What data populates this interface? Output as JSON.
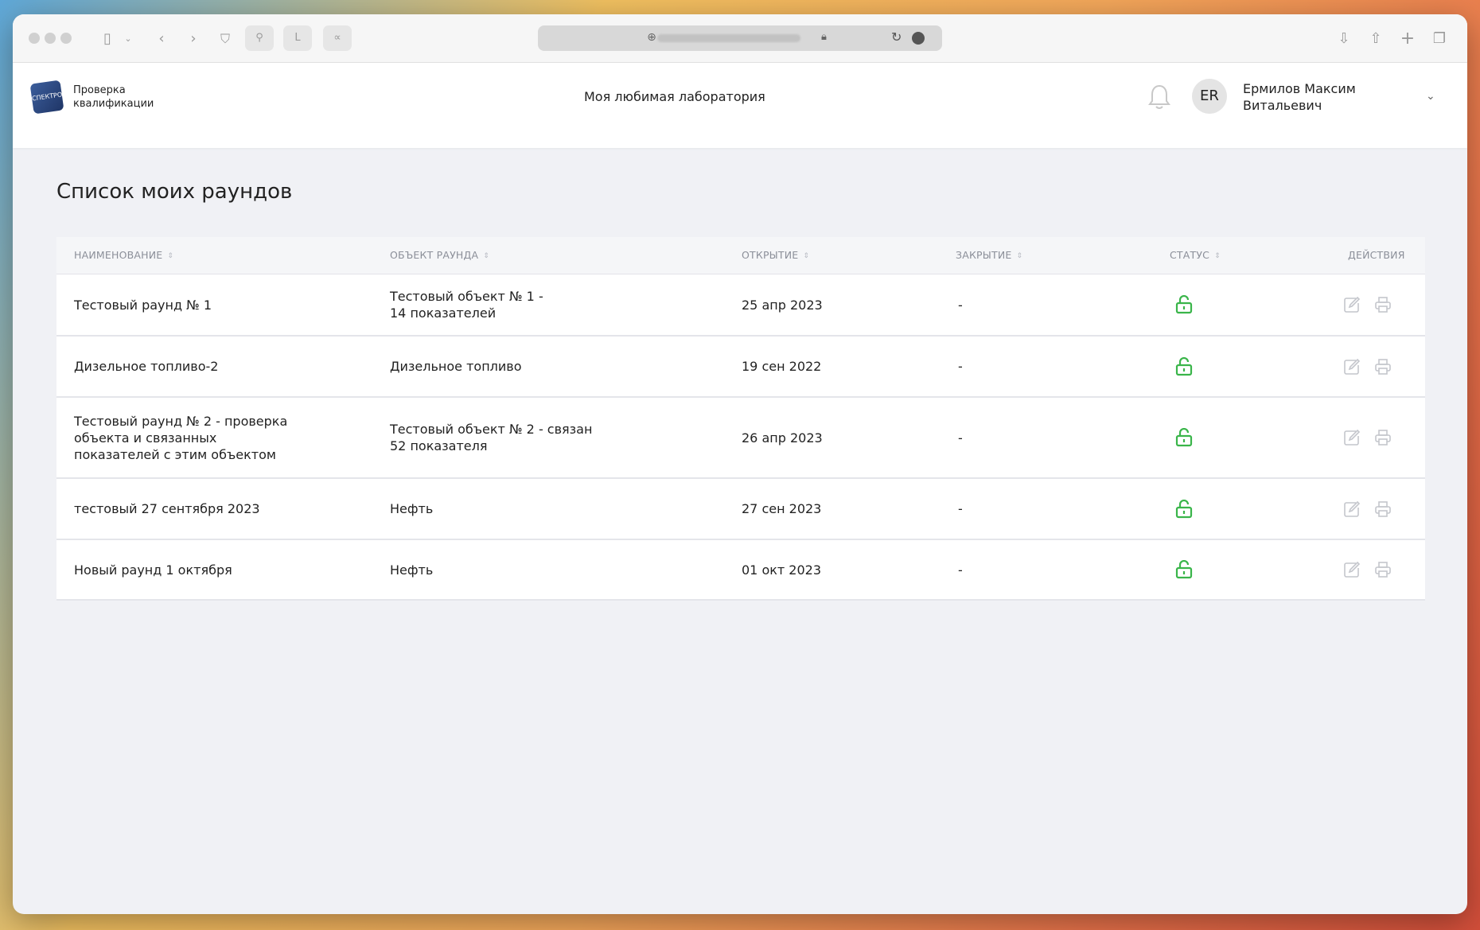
{
  "app": {
    "logo_label": "СПЕКТРО",
    "logo_text": "Проверка квалификации",
    "lab_name": "Моя любимая лаборатория",
    "user_initials": "ER",
    "user_name": "Ермилов Максим Витальевич"
  },
  "page": {
    "title": "Список моих раундов"
  },
  "table": {
    "headers": {
      "name": "НАИМЕНОВАНИЕ",
      "object": "ОБЪЕКТ РАУНДА",
      "opening": "ОТКРЫТИЕ",
      "closing": "ЗАКРЫТИЕ",
      "status": "СТАТУС",
      "actions": "ДЕЙСТВИЯ"
    },
    "rows": [
      {
        "name": "Тестовый раунд № 1",
        "object": "Тестовый объект № 1 - 14 показателей",
        "opening": "25 апр 2023",
        "closing": "-",
        "status": "open"
      },
      {
        "name": "Дизельное топливо-2",
        "object": "Дизельное топливо",
        "opening": "19 сен 2022",
        "closing": "-",
        "status": "open"
      },
      {
        "name": "Тестовый раунд № 2 - проверка объекта и связанных показателей с этим объектом",
        "object": "Тестовый объект № 2 - связан 52 показателя",
        "opening": "26 апр 2023",
        "closing": "-",
        "status": "open"
      },
      {
        "name": "тестовый 27 сентября 2023",
        "object": "Нефть",
        "opening": "27 сен 2023",
        "closing": "-",
        "status": "open"
      },
      {
        "name": "Новый раунд 1 октября",
        "object": "Нефть",
        "opening": "01 окт 2023",
        "closing": "-",
        "status": "open"
      }
    ]
  },
  "colors": {
    "status_open": "#3ab54a",
    "action_icon": "#c4c6cc"
  }
}
